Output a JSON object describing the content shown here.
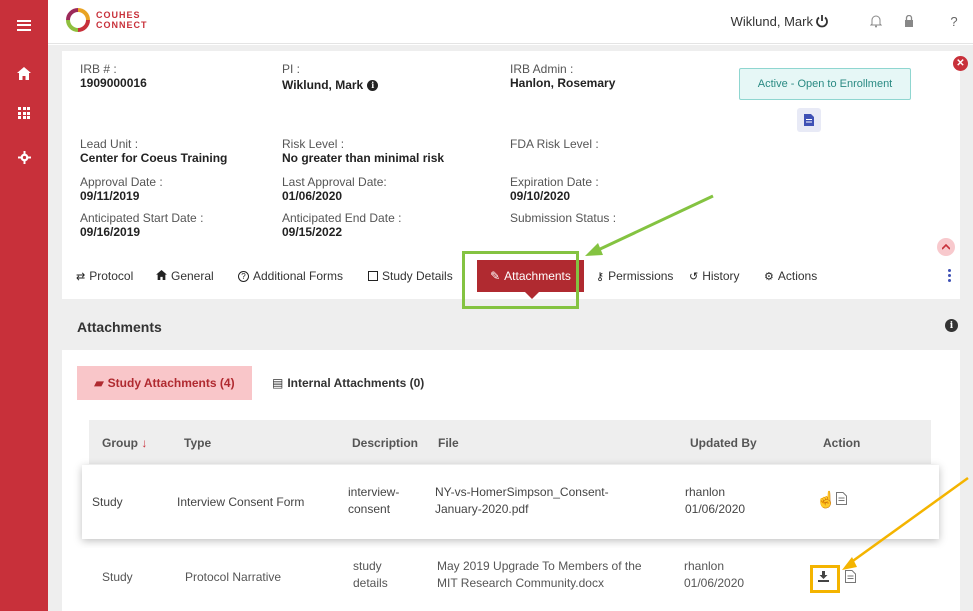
{
  "app": {
    "logo_line1": "COUHES",
    "logo_line2": "CONNECT",
    "user_name": "Wiklund, Mark"
  },
  "protocol": {
    "irb_label": "IRB # :",
    "irb_value": "1909000016",
    "pi_label": "PI :",
    "pi_value": "Wiklund, Mark",
    "irb_admin_label": "IRB Admin :",
    "irb_admin_value": "Hanlon, Rosemary",
    "status": "Active - Open to Enrollment",
    "lead_unit_label": "Lead Unit :",
    "lead_unit_value": "Center for Coeus Training",
    "risk_level_label": "Risk Level :",
    "risk_level_value": "No greater than minimal risk",
    "fda_risk_label": "FDA Risk Level :",
    "approval_date_label": "Approval Date :",
    "approval_date_value": "09/11/2019",
    "last_approval_label": "Last Approval Date:",
    "last_approval_value": "01/06/2020",
    "expiration_label": "Expiration Date :",
    "expiration_value": "09/10/2020",
    "anticipated_start_label": "Anticipated Start Date :",
    "anticipated_start_value": "09/16/2019",
    "anticipated_end_label": "Anticipated End Date :",
    "anticipated_end_value": "09/15/2022",
    "submission_status_label": "Submission Status :"
  },
  "tabs": [
    {
      "label": "Protocol"
    },
    {
      "label": "General"
    },
    {
      "label": "Additional Forms"
    },
    {
      "label": "Study Details"
    },
    {
      "label": "Attachments"
    },
    {
      "label": "Permissions"
    },
    {
      "label": "History"
    },
    {
      "label": "Actions"
    }
  ],
  "attachments": {
    "heading": "Attachments",
    "subtab_study": "Study Attachments (4)",
    "subtab_internal": "Internal Attachments (0)",
    "columns": {
      "group": "Group",
      "type": "Type",
      "description": "Description",
      "file": "File",
      "updated_by": "Updated By",
      "action": "Action"
    },
    "rows": [
      {
        "group": "Study",
        "type": "Interview Consent Form",
        "description_l1": "interview-",
        "description_l2": "consent",
        "file_l1": "NY-vs-HomerSimpson_Consent-",
        "file_l2": "January-2020.pdf",
        "updated_by": "rhanlon",
        "updated_date": "01/06/2020"
      },
      {
        "group": "Study",
        "type": "Protocol Narrative",
        "description_l1": "study",
        "description_l2": "details",
        "file_l1": "May 2019 Upgrade To Members of the",
        "file_l2": "MIT Research Community.docx",
        "updated_by": "rhanlon",
        "updated_date": "01/06/2020"
      }
    ]
  },
  "colors": {
    "brand_red": "#c8303a",
    "tab_active": "#b02a30",
    "highlight_green": "#84c341",
    "highlight_yellow": "#f4b400",
    "status_teal": "#2a8a83"
  }
}
